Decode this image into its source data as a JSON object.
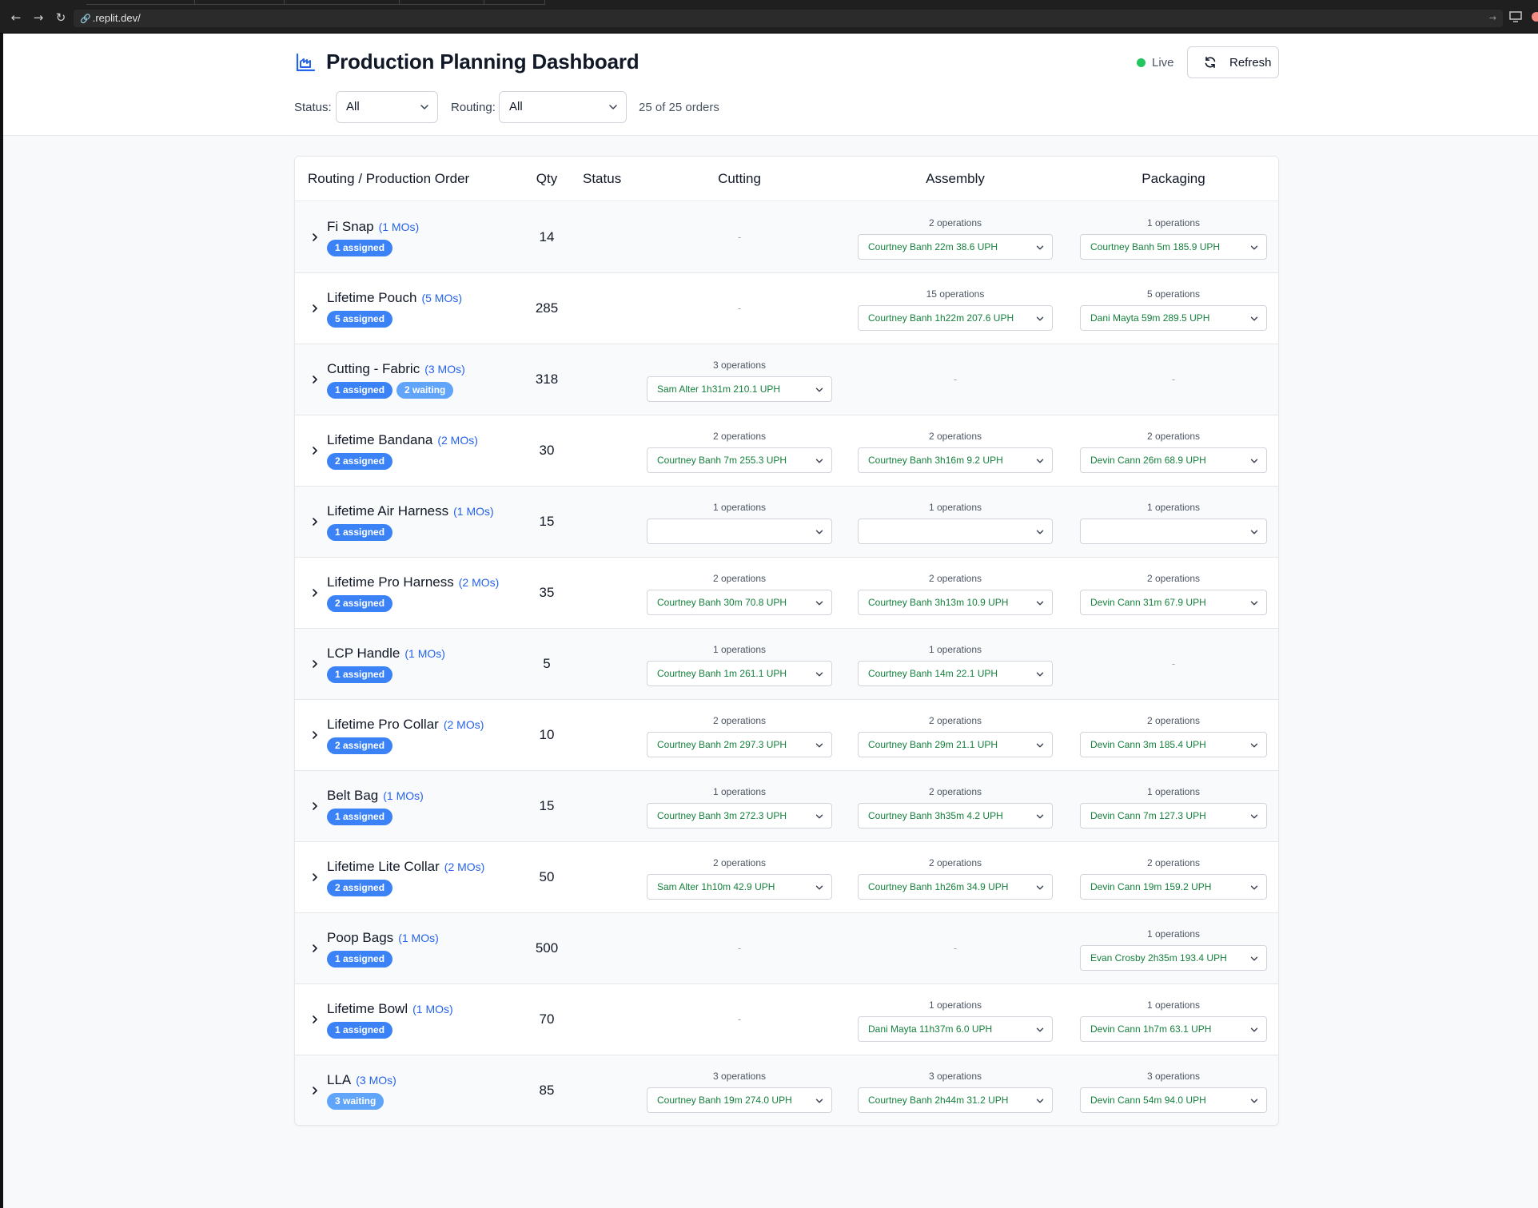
{
  "browser": {
    "url": ".replit.dev/"
  },
  "header": {
    "title": "Production Planning Dashboard",
    "live_label": "Live",
    "refresh_label": "Refresh",
    "status_label": "Status:",
    "status_value": "All",
    "routing_label": "Routing:",
    "routing_value": "All",
    "order_count": "25 of 25 orders",
    "live_color": "#22c55e",
    "accent_color": "#2563eb"
  },
  "table": {
    "columns": [
      "Routing / Production Order",
      "Qty",
      "Status",
      "Cutting",
      "Assembly",
      "Packaging"
    ],
    "rows": [
      {
        "name": "Fi Snap",
        "mos": "(1 MOs)",
        "badges": [
          {
            "text": "1 assigned",
            "kind": "assigned"
          }
        ],
        "qty": "14",
        "cutting": null,
        "assembly": {
          "ops": "2 operations",
          "value": "Courtney Banh  22m 38.6 UPH"
        },
        "packaging": {
          "ops": "1 operations",
          "value": "Courtney Banh  5m 185.9 UPH"
        }
      },
      {
        "name": "Lifetime Pouch",
        "mos": "(5 MOs)",
        "badges": [
          {
            "text": "5 assigned",
            "kind": "assigned"
          }
        ],
        "qty": "285",
        "cutting": null,
        "assembly": {
          "ops": "15 operations",
          "value": "Courtney Banh  1h22m 207.6 UPH"
        },
        "packaging": {
          "ops": "5 operations",
          "value": "Dani Mayta  59m 289.5 UPH"
        }
      },
      {
        "name": "Cutting - Fabric",
        "mos": "(3 MOs)",
        "badges": [
          {
            "text": "1 assigned",
            "kind": "assigned"
          },
          {
            "text": "2 waiting",
            "kind": "waiting"
          }
        ],
        "qty": "318",
        "cutting": {
          "ops": "3 operations",
          "value": "Sam Alter  1h31m 210.1 UPH"
        },
        "assembly": null,
        "packaging": null
      },
      {
        "name": "Lifetime Bandana",
        "mos": "(2 MOs)",
        "badges": [
          {
            "text": "2 assigned",
            "kind": "assigned"
          }
        ],
        "qty": "30",
        "cutting": {
          "ops": "2 operations",
          "value": "Courtney Banh  7m 255.3 UPH"
        },
        "assembly": {
          "ops": "2 operations",
          "value": "Courtney Banh  3h16m 9.2 UPH"
        },
        "packaging": {
          "ops": "2 operations",
          "value": "Devin Cann  26m 68.9 UPH"
        }
      },
      {
        "name": "Lifetime Air Harness",
        "mos": "(1 MOs)",
        "badges": [
          {
            "text": "1 assigned",
            "kind": "assigned"
          }
        ],
        "qty": "15",
        "cutting": {
          "ops": "1 operations",
          "value": ""
        },
        "assembly": {
          "ops": "1 operations",
          "value": ""
        },
        "packaging": {
          "ops": "1 operations",
          "value": ""
        }
      },
      {
        "name": "Lifetime Pro Harness",
        "mos": "(2 MOs)",
        "badges": [
          {
            "text": "2 assigned",
            "kind": "assigned"
          }
        ],
        "qty": "35",
        "cutting": {
          "ops": "2 operations",
          "value": "Courtney Banh  30m 70.8 UPH"
        },
        "assembly": {
          "ops": "2 operations",
          "value": "Courtney Banh  3h13m 10.9 UPH"
        },
        "packaging": {
          "ops": "2 operations",
          "value": "Devin Cann  31m 67.9 UPH"
        }
      },
      {
        "name": "LCP Handle",
        "mos": "(1 MOs)",
        "badges": [
          {
            "text": "1 assigned",
            "kind": "assigned"
          }
        ],
        "qty": "5",
        "cutting": {
          "ops": "1 operations",
          "value": "Courtney Banh  1m 261.1 UPH"
        },
        "assembly": {
          "ops": "1 operations",
          "value": "Courtney Banh  14m 22.1 UPH"
        },
        "packaging": null
      },
      {
        "name": "Lifetime Pro Collar",
        "mos": "(2 MOs)",
        "badges": [
          {
            "text": "2 assigned",
            "kind": "assigned"
          }
        ],
        "qty": "10",
        "cutting": {
          "ops": "2 operations",
          "value": "Courtney Banh  2m 297.3 UPH"
        },
        "assembly": {
          "ops": "2 operations",
          "value": "Courtney Banh  29m 21.1 UPH"
        },
        "packaging": {
          "ops": "2 operations",
          "value": "Devin Cann  3m 185.4 UPH"
        }
      },
      {
        "name": "Belt Bag",
        "mos": "(1 MOs)",
        "badges": [
          {
            "text": "1 assigned",
            "kind": "assigned"
          }
        ],
        "qty": "15",
        "cutting": {
          "ops": "1 operations",
          "value": "Courtney Banh  3m 272.3 UPH"
        },
        "assembly": {
          "ops": "2 operations",
          "value": "Courtney Banh  3h35m 4.2 UPH"
        },
        "packaging": {
          "ops": "1 operations",
          "value": "Devin Cann  7m 127.3 UPH"
        }
      },
      {
        "name": "Lifetime Lite Collar",
        "mos": "(2 MOs)",
        "badges": [
          {
            "text": "2 assigned",
            "kind": "assigned"
          }
        ],
        "qty": "50",
        "cutting": {
          "ops": "2 operations",
          "value": "Sam Alter  1h10m 42.9 UPH"
        },
        "assembly": {
          "ops": "2 operations",
          "value": "Courtney Banh  1h26m 34.9 UPH"
        },
        "packaging": {
          "ops": "2 operations",
          "value": "Devin Cann  19m 159.2 UPH"
        }
      },
      {
        "name": "Poop Bags",
        "mos": "(1 MOs)",
        "badges": [
          {
            "text": "1 assigned",
            "kind": "assigned"
          }
        ],
        "qty": "500",
        "cutting": null,
        "assembly": null,
        "packaging": {
          "ops": "1 operations",
          "value": "Evan Crosby  2h35m 193.4 UPH"
        }
      },
      {
        "name": "Lifetime Bowl",
        "mos": "(1 MOs)",
        "badges": [
          {
            "text": "1 assigned",
            "kind": "assigned"
          }
        ],
        "qty": "70",
        "cutting": null,
        "assembly": {
          "ops": "1 operations",
          "value": "Dani Mayta  11h37m 6.0 UPH"
        },
        "packaging": {
          "ops": "1 operations",
          "value": "Devin Cann  1h7m 63.1 UPH"
        }
      },
      {
        "name": "LLA",
        "mos": "(3 MOs)",
        "badges": [
          {
            "text": "3 waiting",
            "kind": "waiting"
          }
        ],
        "qty": "85",
        "cutting": {
          "ops": "3 operations",
          "value": "Courtney Banh  19m 274.0 UPH"
        },
        "assembly": {
          "ops": "3 operations",
          "value": "Courtney Banh  2h44m 31.2 UPH"
        },
        "packaging": {
          "ops": "3 operations",
          "value": "Devin Cann  54m 94.0 UPH"
        }
      }
    ],
    "empty_placeholder": "-"
  }
}
